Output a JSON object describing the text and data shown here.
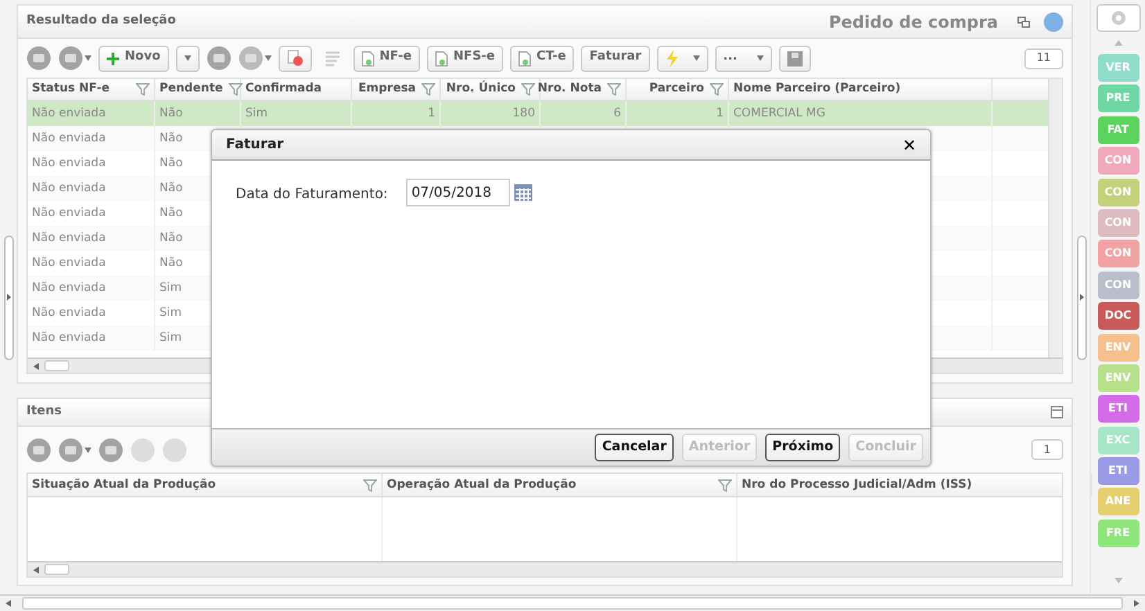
{
  "top_panel": {
    "title": "Resultado da seleção",
    "subtitle": "Pedido de compra",
    "toolbar": {
      "new_button": "Novo",
      "nfe_button": "NF-e",
      "nfse_button": "NFS-e",
      "cte_button": "CT-e",
      "invoice_button": "Faturar",
      "more_button": "...",
      "record_count": "11"
    },
    "table": {
      "columns": [
        {
          "label": "Status NF-e",
          "filter": true,
          "kind": "text"
        },
        {
          "label": "Pendente",
          "filter": true,
          "kind": "text"
        },
        {
          "label": "Confirmada",
          "filter": false,
          "kind": "text"
        },
        {
          "label": "Empresa",
          "filter": true,
          "kind": "number"
        },
        {
          "label": "Nro. Único",
          "filter": true,
          "kind": "number"
        },
        {
          "label": "Nro. Nota",
          "filter": true,
          "kind": "number"
        },
        {
          "label": "Parceiro",
          "filter": true,
          "kind": "number"
        },
        {
          "label": "Nome Parceiro (Parceiro)",
          "filter": false,
          "kind": "text"
        }
      ],
      "rows": [
        {
          "selected": true,
          "cells": [
            "Não enviada",
            "Não",
            "Sim",
            "1",
            "180",
            "6",
            "1",
            "COMERCIAL MG"
          ]
        },
        {
          "selected": false,
          "cells": [
            "Não enviada",
            "Não"
          ]
        },
        {
          "selected": false,
          "cells": [
            "Não enviada",
            "Não"
          ]
        },
        {
          "selected": false,
          "cells": [
            "Não enviada",
            "Não"
          ]
        },
        {
          "selected": false,
          "cells": [
            "Não enviada",
            "Não"
          ]
        },
        {
          "selected": false,
          "cells": [
            "Não enviada",
            "Não"
          ]
        },
        {
          "selected": false,
          "cells": [
            "Não enviada",
            "Não"
          ]
        },
        {
          "selected": false,
          "cells": [
            "Não enviada",
            "Sim"
          ]
        },
        {
          "selected": false,
          "cells": [
            "Não enviada",
            "Sim"
          ]
        },
        {
          "selected": false,
          "cells": [
            "Não enviada",
            "Sim"
          ]
        }
      ]
    }
  },
  "items_panel": {
    "title": "Itens",
    "record_count": "1",
    "columns": [
      {
        "label": "Situação Atual da Produção",
        "filter": true
      },
      {
        "label": "Operação Atual da Produção",
        "filter": true
      },
      {
        "label": "Nro do Processo Judicial/Adm (ISS)",
        "filter": false
      }
    ]
  },
  "dialog": {
    "title": "Faturar",
    "close": "✕",
    "field_label": "Data do Faturamento:",
    "field_value": "07/05/2018",
    "buttons": [
      {
        "label": "Cancelar",
        "disabled": false
      },
      {
        "label": "Anterior",
        "disabled": true
      },
      {
        "label": "Próximo",
        "disabled": false
      },
      {
        "label": "Concluir",
        "disabled": true
      }
    ]
  },
  "side_tags": [
    {
      "label": "VER",
      "color": "#8fdccb"
    },
    {
      "label": "PRE",
      "color": "#6ed8a5"
    },
    {
      "label": "FAT",
      "color": "#5cd35c"
    },
    {
      "label": "CON",
      "color": "#f0a8bc"
    },
    {
      "label": "CON",
      "color": "#c5d07a"
    },
    {
      "label": "CON",
      "color": "#dcbcbe"
    },
    {
      "label": "CON",
      "color": "#f2a2a2"
    },
    {
      "label": "CON",
      "color": "#babdca"
    },
    {
      "label": "DOC",
      "color": "#c85a5a"
    },
    {
      "label": "ENV",
      "color": "#f6c08e"
    },
    {
      "label": "ENV",
      "color": "#b6e08a"
    },
    {
      "label": "ETI",
      "color": "#d46be8"
    },
    {
      "label": "EXC",
      "color": "#a6e5c5"
    },
    {
      "label": "ETI",
      "color": "#9a9ae6"
    },
    {
      "label": "ANE",
      "color": "#e6cf6e"
    },
    {
      "label": "FRE",
      "color": "#8ee57a"
    }
  ]
}
